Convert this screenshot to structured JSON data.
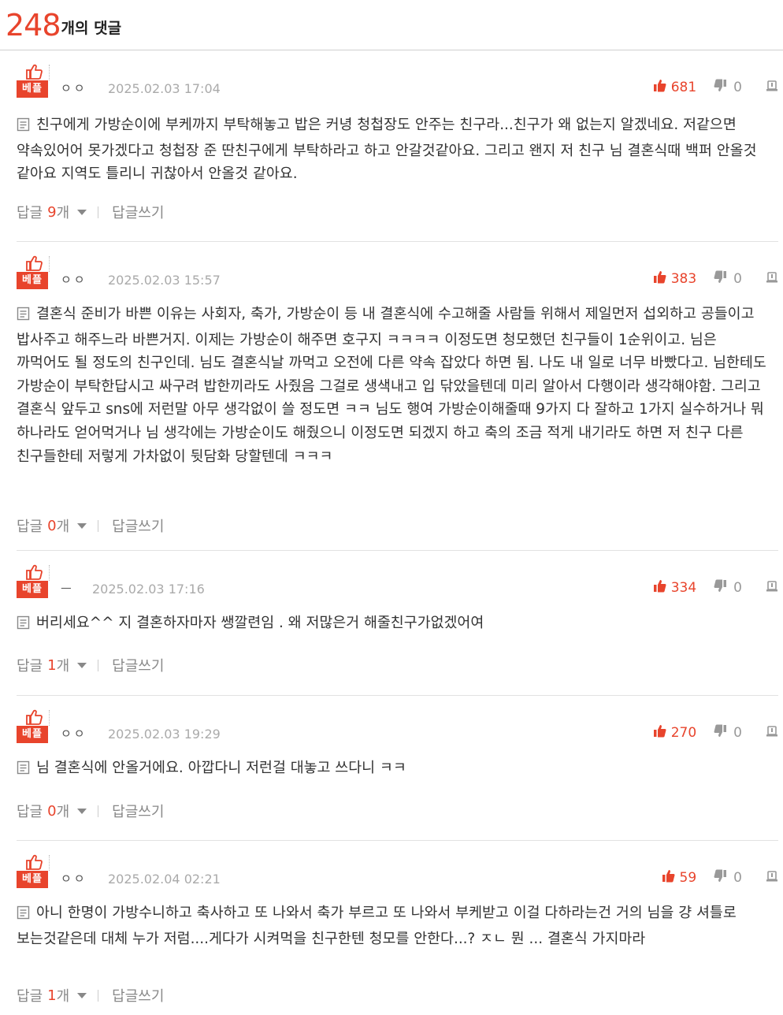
{
  "header": {
    "count": "248",
    "label": "개의 댓글"
  },
  "colors": {
    "accent": "#e8442c"
  },
  "best_label": "베플",
  "reply_label": "답글",
  "reply_unit": "개",
  "write_reply_label": "답글쓰기",
  "comments": [
    {
      "author": "ㅇㅇ",
      "date": "2025.02.03 17:04",
      "likes": "681",
      "dislikes": "0",
      "text": "친구에게 가방순이에 부케까지 부탁해놓고 밥은 커녕 청첩장도 안주는 친구라...친구가 왜 없는지 알겠네요. 저같으면 약속있어어 못가겠다고 청첩장 준 딴친구에게 부탁하라고 하고 안갈것같아요. 그리고 왠지 저 친구 님 결혼식때 백퍼 안올것 같아요 지역도 틀리니 귀찮아서 안올것 같아요.",
      "reply_count": "9"
    },
    {
      "author": "ㅇㅇ",
      "date": "2025.02.03 15:57",
      "likes": "383",
      "dislikes": "0",
      "text": "결혼식 준비가 바쁜 이유는 사회자, 축가, 가방순이 등 내 결혼식에 수고해줄 사람들 위해서 제일먼저 섭외하고 공들이고 밥사주고 해주느라 바쁜거지. 이제는 가방순이 해주면 호구지 ㅋㅋㅋㅋ 이정도면 청모했던 친구들이 1순위이고. 님은 까먹어도 될 정도의 친구인데. 님도 결혼식날 까먹고 오전에 다른 약속 잡았다 하면 됨. 나도 내 일로 너무 바빴다고. 님한테도 가방순이 부탁한답시고 싸구려 밥한끼라도 사줬음 그걸로 생색내고 입 닦았을텐데 미리 알아서 다행이라 생각해야함. 그리고 결혼식 앞두고 sns에 저런말 아무 생각없이 쓸 정도면 ㅋㅋ 님도 행여 가방순이해줄때 9가지 다 잘하고 1가지 실수하거나 뭐 하나라도 얻어먹거나 님 생각에는 가방순이도 해줬으니 이정도면 되겠지 하고 축의 조금 적게 내기라도 하면 저 친구 다른 친구들한테 저렇게 가차없이 뒷담화 당할텐데 ㅋㅋㅋ",
      "reply_count": "0"
    },
    {
      "author": "ㅡ",
      "date": "2025.02.03 17:16",
      "likes": "334",
      "dislikes": "0",
      "text": "버리세요^^ 지 결혼하자마자 쌩깔련임 . 왜 저많은거 해줄친구가없겠어여",
      "reply_count": "1"
    },
    {
      "author": "ㅇㅇ",
      "date": "2025.02.03 19:29",
      "likes": "270",
      "dislikes": "0",
      "text": "님 결혼식에 안올거에요. 아깝다니 저런걸 대놓고 쓰다니 ㅋㅋ",
      "reply_count": "0"
    },
    {
      "author": "ㅇㅇ",
      "date": "2025.02.04 02:21",
      "likes": "59",
      "dislikes": "0",
      "text": "아니 한명이 가방수니하고 축사하고 또 나와서 축가 부르고 또 나와서 부케받고 이걸 다하라는건 거의 님을 걍 셔틀로 보는것같은데 대체 누가 저럼....게다가 시켜먹을 친구한텐 청모를 안한다...? ㅈㄴ 뭔 ... 결혼식 가지마라",
      "reply_count": "1"
    }
  ]
}
